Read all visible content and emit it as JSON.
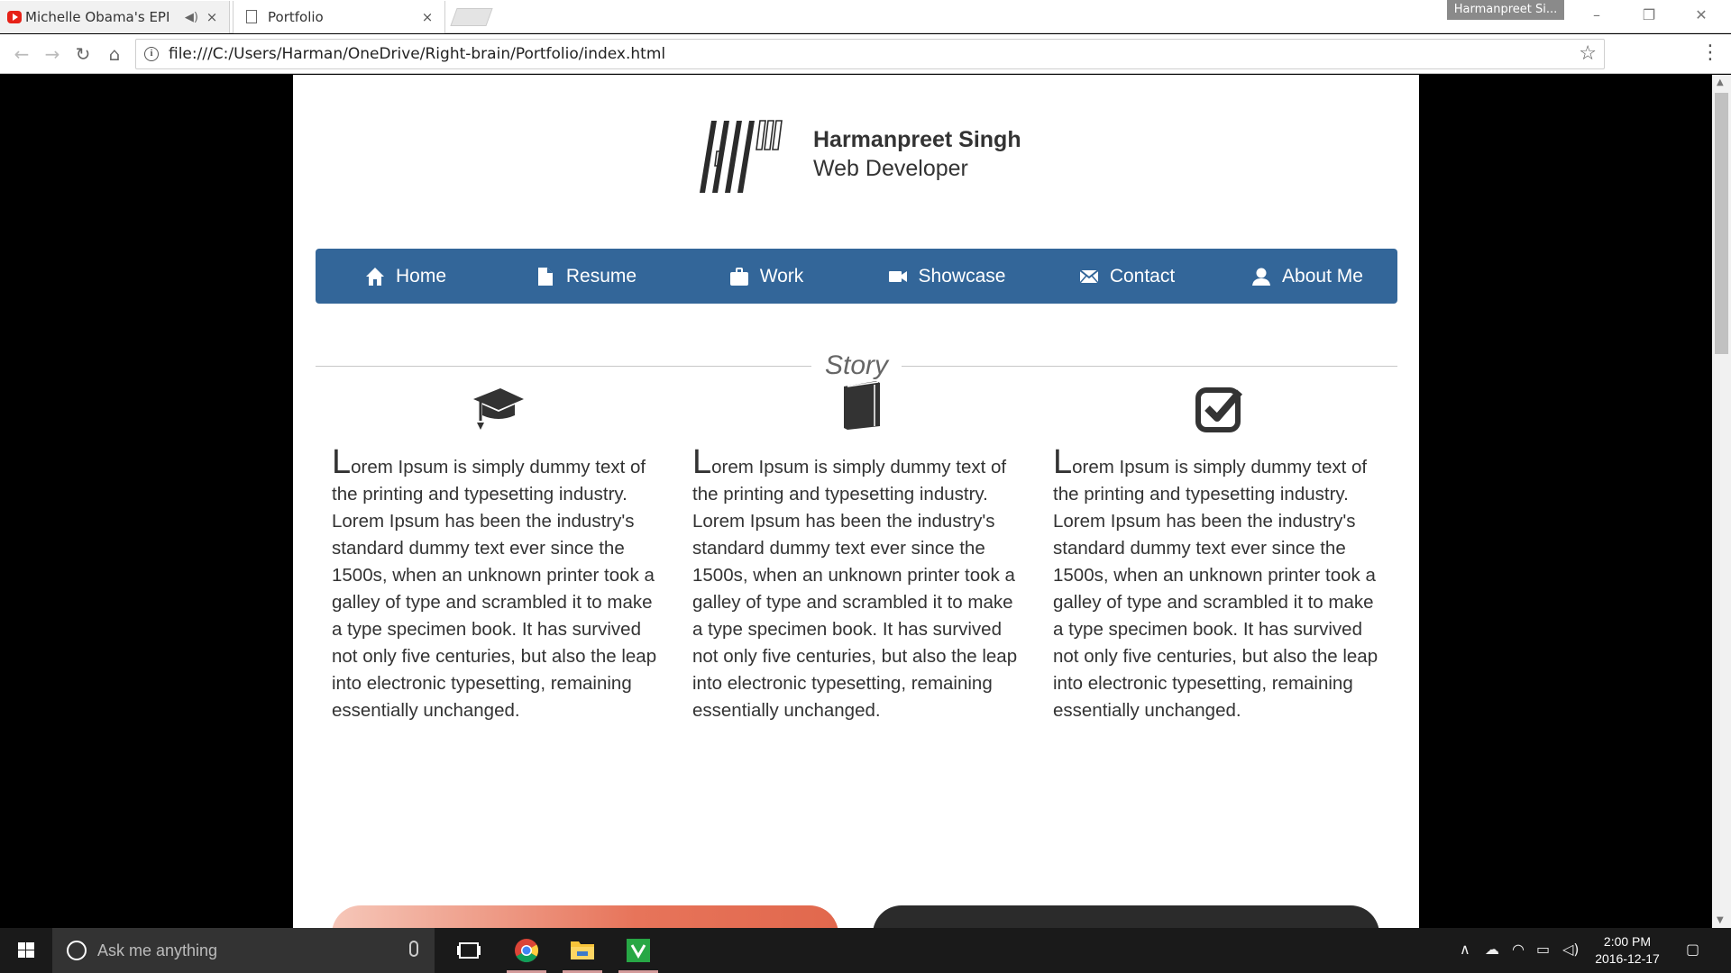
{
  "browser": {
    "tabs": [
      {
        "title": "Michelle Obama's EPI",
        "close": "×"
      },
      {
        "title": "Portfolio",
        "close": "×"
      }
    ],
    "profile": "Harmanpreet Si...",
    "window_controls": {
      "minimize": "–",
      "restore": "❐",
      "close": "✕"
    },
    "url": "file:///C:/Users/Harman/OneDrive/Right-brain/Portfolio/index.html"
  },
  "page": {
    "header": {
      "name": "Harmanpreet Singh",
      "role": "Web Developer"
    },
    "nav": [
      {
        "label": "Home",
        "icon": "home-icon"
      },
      {
        "label": "Resume",
        "icon": "document-icon"
      },
      {
        "label": "Work",
        "icon": "briefcase-icon"
      },
      {
        "label": "Showcase",
        "icon": "video-camera-icon"
      },
      {
        "label": "Contact",
        "icon": "envelope-icon"
      },
      {
        "label": "About Me",
        "icon": "user-icon"
      }
    ],
    "section_title": "Story",
    "columns": [
      {
        "icon": "graduation-cap-icon",
        "drop_cap": "L",
        "text": "orem Ipsum is simply dummy text of the printing and typesetting industry. Lorem Ipsum has been the industry's standard dummy text ever since the 1500s, when an unknown printer took a galley of type and scrambled it to make a type specimen book. It has survived not only five centuries, but also the leap into electronic typesetting, remaining essentially unchanged."
      },
      {
        "icon": "book-icon",
        "drop_cap": "L",
        "text": "orem Ipsum is simply dummy text of the printing and typesetting industry. Lorem Ipsum has been the industry's standard dummy text ever since the 1500s, when an unknown printer took a galley of type and scrambled it to make a type specimen book. It has survived not only five centuries, but also the leap into electronic typesetting, remaining essentially unchanged."
      },
      {
        "icon": "checkbox-icon",
        "drop_cap": "L",
        "text": "orem Ipsum is simply dummy text of the printing and typesetting industry. Lorem Ipsum has been the industry's standard dummy text ever since the 1500s, when an unknown printer took a galley of type and scrambled it to make a type specimen book. It has survived not only five centuries, but also the leap into electronic typesetting, remaining essentially unchanged."
      }
    ]
  },
  "taskbar": {
    "search_placeholder": "Ask me anything",
    "time": "2:00 PM",
    "date": "2016-12-17"
  }
}
